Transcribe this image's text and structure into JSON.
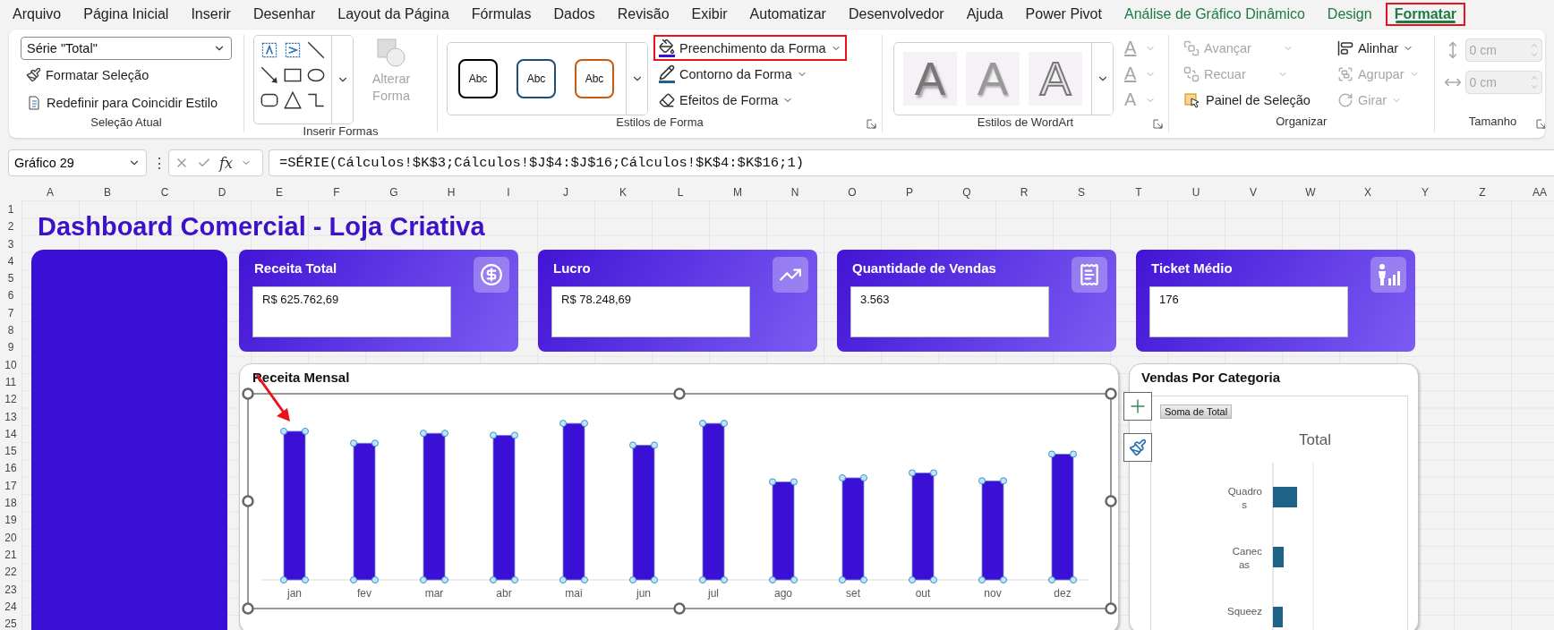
{
  "menu_tabs": [
    {
      "label": "Arquivo",
      "selected": false,
      "contextual": false,
      "annotated": false
    },
    {
      "label": "Página Inicial",
      "selected": false,
      "contextual": false,
      "annotated": false
    },
    {
      "label": "Inserir",
      "selected": false,
      "contextual": false,
      "annotated": false
    },
    {
      "label": "Desenhar",
      "selected": false,
      "contextual": false,
      "annotated": false
    },
    {
      "label": "Layout da Página",
      "selected": false,
      "contextual": false,
      "annotated": false
    },
    {
      "label": "Fórmulas",
      "selected": false,
      "contextual": false,
      "annotated": false
    },
    {
      "label": "Dados",
      "selected": false,
      "contextual": false,
      "annotated": false
    },
    {
      "label": "Revisão",
      "selected": false,
      "contextual": false,
      "annotated": false
    },
    {
      "label": "Exibir",
      "selected": false,
      "contextual": false,
      "annotated": false
    },
    {
      "label": "Automatizar",
      "selected": false,
      "contextual": false,
      "annotated": false
    },
    {
      "label": "Desenvolvedor",
      "selected": false,
      "contextual": false,
      "annotated": false
    },
    {
      "label": "Ajuda",
      "selected": false,
      "contextual": false,
      "annotated": false
    },
    {
      "label": "Power Pivot",
      "selected": false,
      "contextual": false,
      "annotated": false
    },
    {
      "label": "Análise de Gráfico Dinâmico",
      "selected": false,
      "contextual": true,
      "annotated": false
    },
    {
      "label": "Design",
      "selected": false,
      "contextual": true,
      "annotated": false
    },
    {
      "label": "Formatar",
      "selected": true,
      "contextual": true,
      "annotated": true
    }
  ],
  "ribbon": {
    "selecao_atual": {
      "label": "Seleção Atual",
      "selector": "Série \"Total\"",
      "commands": [
        "Formatar Seleção",
        "Redefinir para Coincidir Estilo"
      ]
    },
    "inserir_formas": {
      "label": "Inserir Formas",
      "change_shape": {
        "label": "Alterar Forma",
        "disabled": true
      }
    },
    "estilos_de_forma": {
      "label": "Estilos de Forma",
      "presets": [
        {
          "text": "Abc",
          "color": "#000000"
        },
        {
          "text": "Abc",
          "color": "#1f4e79"
        },
        {
          "text": "Abc",
          "color": "#c55a11"
        }
      ],
      "commands": [
        {
          "label": "Preenchimento da Forma",
          "annotated": true
        },
        {
          "label": "Contorno da Forma",
          "annotated": false
        },
        {
          "label": "Efeitos de Forma",
          "annotated": false
        }
      ]
    },
    "estilos_wordart": {
      "label": "Estilos de WordArt",
      "presets": [
        "A",
        "A",
        "A"
      ],
      "text_tools": [
        "A",
        "A",
        "A"
      ]
    },
    "organizar": {
      "label": "Organizar",
      "commands": [
        {
          "label": "Avançar",
          "disabled": true,
          "menu": true
        },
        {
          "label": "Recuar",
          "disabled": true,
          "menu": true
        },
        {
          "label": "Painel de Seleção",
          "disabled": false,
          "menu": false
        },
        {
          "label": "Alinhar",
          "disabled": false,
          "menu": true
        },
        {
          "label": "Agrupar",
          "disabled": true,
          "menu": true
        },
        {
          "label": "Girar",
          "disabled": true,
          "menu": true
        }
      ]
    },
    "tamanho": {
      "label": "Tamanho",
      "fields": [
        {
          "value": "0 cm",
          "disabled": true
        },
        {
          "value": "0 cm",
          "disabled": true
        }
      ]
    }
  },
  "formula_bar": {
    "name_box": "Gráfico 29",
    "more": "⋮",
    "fx": "fx",
    "formula": "=SÉRIE(Cálculos!$K$3;Cálculos!$J$4:$J$16;Cálculos!$K$4:$K$16;1)"
  },
  "sheet": {
    "columns": [
      "A",
      "B",
      "C",
      "D",
      "E",
      "F",
      "G",
      "H",
      "I",
      "J",
      "K",
      "L",
      "M",
      "N",
      "O",
      "P",
      "Q",
      "R",
      "S",
      "T",
      "U",
      "V",
      "W",
      "X",
      "Y",
      "Z",
      "AA"
    ],
    "rows": [
      "1",
      "2",
      "3",
      "4",
      "5",
      "6",
      "7",
      "8",
      "9",
      "10",
      "11",
      "12",
      "13",
      "14",
      "15",
      "16",
      "17",
      "18",
      "19",
      "20",
      "21",
      "22",
      "23",
      "24",
      "25"
    ]
  },
  "dashboard": {
    "title": "Dashboard Comercial - Loja Criativa",
    "kpis": [
      {
        "title": "Receita Total",
        "value": "R$ 625.762,69"
      },
      {
        "title": "Lucro",
        "value": "R$ 78.248,69"
      },
      {
        "title": "Quantidade de Vendas",
        "value": "3.563"
      },
      {
        "title": "Ticket Médio",
        "value": "176"
      }
    ],
    "receita_mensal": {
      "title": "Receita Mensal",
      "selected": true,
      "categories": [
        "jan",
        "fev",
        "mar",
        "abr",
        "mai",
        "jun",
        "jul",
        "ago",
        "set",
        "out",
        "nov",
        "dez"
      ]
    },
    "vendas_por_categoria": {
      "title": "Vendas Por Categoria",
      "field_button": "Soma de Total",
      "chart_title": "Total",
      "categories": [
        {
          "lines": [
            "Quadro",
            "s"
          ]
        },
        {
          "lines": [
            "Canec",
            "as"
          ]
        },
        {
          "lines": [
            "Squeez"
          ]
        }
      ]
    }
  }
}
